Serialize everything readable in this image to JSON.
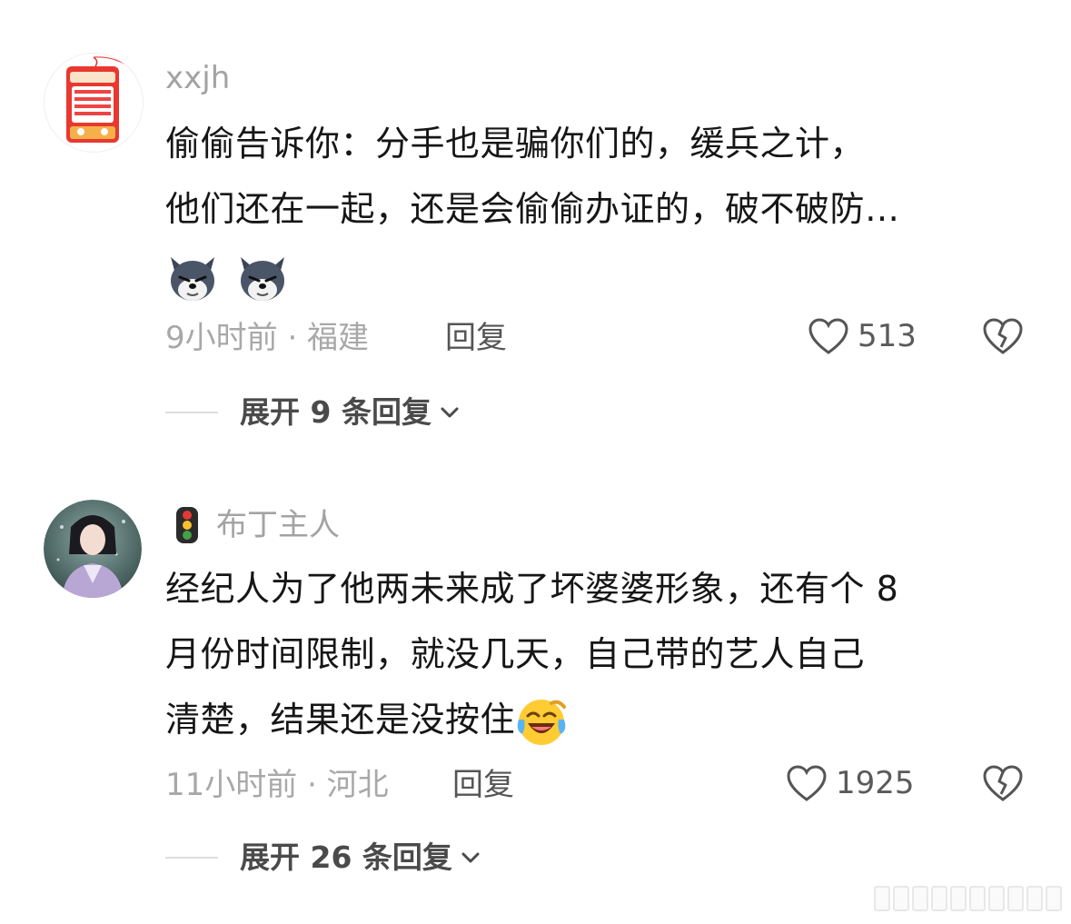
{
  "comments": [
    {
      "username": "xxjh",
      "lines": [
        "偷偷告诉你：分手也是骗你们的，缓兵之计，",
        "他们还在一起，还是会偷偷办证的，破不破防…"
      ],
      "emoji": [
        "dog-face-emoji",
        "dog-face-emoji"
      ],
      "meta": "9小时前 · 福建",
      "reply_label": "回复",
      "likes": "513",
      "expand_label": "展开 9 条回复"
    },
    {
      "username": "布丁主人",
      "lines": [
        "经纪人为了他两未来成了坏婆婆形象，还有个 8",
        "月份时间限制，就没几天，自己带的艺人自己",
        "清楚，结果还是没按住"
      ],
      "emoji": [
        "laughing-tears-emoji"
      ],
      "meta": "11小时前 · 河北",
      "reply_label": "回复",
      "likes": "1925",
      "expand_label": "展开 26 条回复"
    }
  ],
  "colors": {
    "meta": "#a8a8a8",
    "text": "#161616",
    "accent_red": "#e8382f"
  }
}
